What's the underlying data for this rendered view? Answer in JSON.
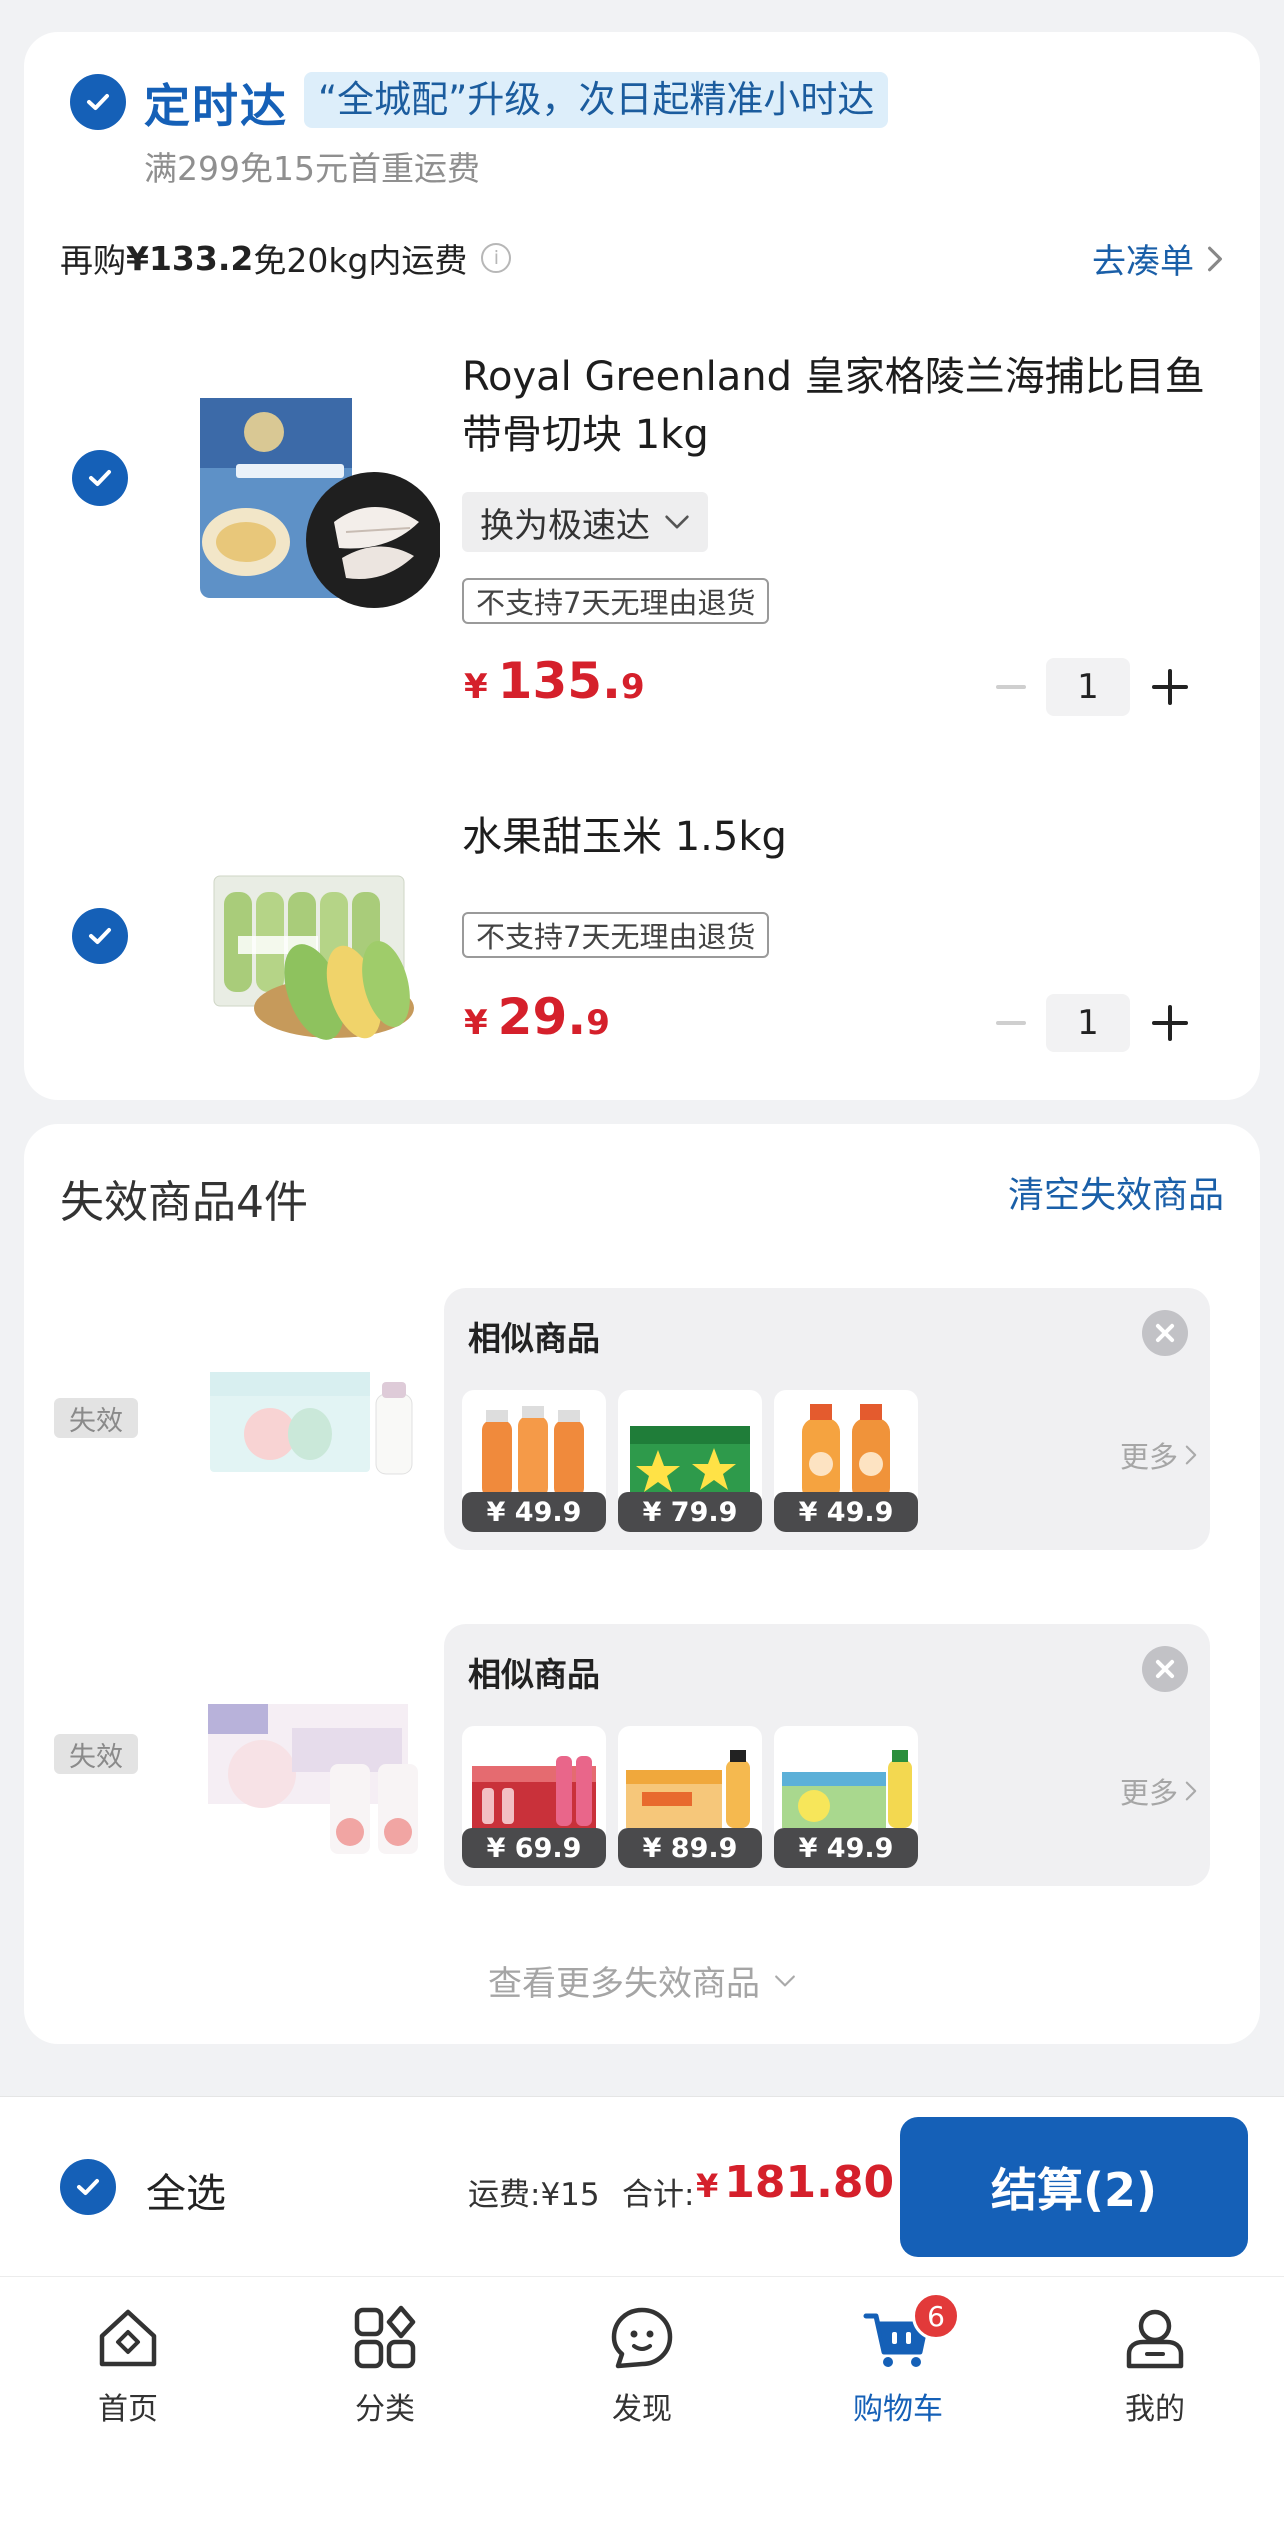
{
  "delivery": {
    "checked": true,
    "name": "定时达",
    "banner": "“全城配”升级，次日起精准小时达",
    "subtitle": "满299免15元首重运费",
    "freight_hint_prefix": "再购",
    "freight_hint_amount": "¥133.2",
    "freight_hint_suffix": "免20kg内运费",
    "add_more_link": "去凑单"
  },
  "cart_items": [
    {
      "checked": true,
      "title": "Royal Greenland 皇家格陵兰海捕比目鱼带骨切块 1kg",
      "switch_option": "换为极速达",
      "tag": "不支持7天无理由退货",
      "price_symbol": "¥",
      "price_int": "135.",
      "price_dec": "9",
      "quantity": "1"
    },
    {
      "checked": true,
      "title": "水果甜玉米 1.5kg",
      "tag": "不支持7天无理由退货",
      "price_symbol": "¥",
      "price_int": "29.",
      "price_dec": "9",
      "quantity": "1"
    }
  ],
  "invalid": {
    "header": "失效商品4件",
    "clear_link": "清空失效商品",
    "items": [
      {
        "badge": "失效",
        "similar_title": "相似商品",
        "similar_prices": [
          "¥ 49.9",
          "¥ 79.9",
          "¥ 49.9"
        ],
        "more": "更多"
      },
      {
        "badge": "失效",
        "similar_title": "相似商品",
        "similar_prices": [
          "¥ 69.9",
          "¥ 89.9",
          "¥ 49.9"
        ],
        "more": "更多"
      }
    ],
    "view_more": "查看更多失效商品"
  },
  "checkout": {
    "select_all_checked": true,
    "select_all": "全选",
    "shipping": "运费:¥15",
    "total_label": "合计:",
    "total_symbol": "¥",
    "total": "181.80",
    "button": "结算(2)"
  },
  "tabbar": {
    "items": [
      {
        "label": "首页",
        "icon": "home-icon",
        "active": false
      },
      {
        "label": "分类",
        "icon": "category-icon",
        "active": false
      },
      {
        "label": "发现",
        "icon": "discover-icon",
        "active": false
      },
      {
        "label": "购物车",
        "icon": "cart-icon",
        "active": true,
        "badge": "6"
      },
      {
        "label": "我的",
        "icon": "profile-icon",
        "active": false
      }
    ]
  },
  "colors": {
    "accent": "#1560b7",
    "price": "#d5202b",
    "link": "#1a5fa8"
  }
}
